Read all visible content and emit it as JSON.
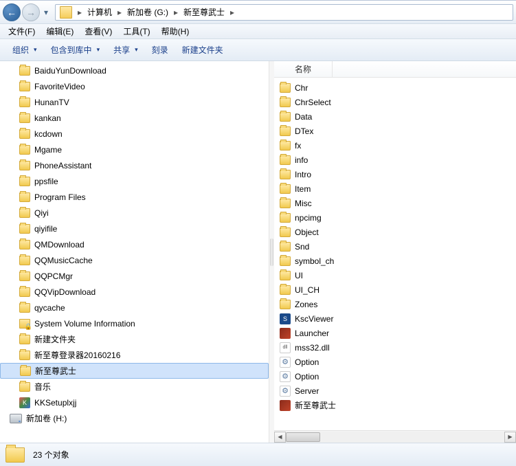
{
  "breadcrumb": [
    {
      "label": "计算机"
    },
    {
      "label": "新加卷 (G:)"
    },
    {
      "label": "新至尊武士"
    }
  ],
  "menubar": [
    {
      "label": "文件(F)"
    },
    {
      "label": "编辑(E)"
    },
    {
      "label": "查看(V)"
    },
    {
      "label": "工具(T)"
    },
    {
      "label": "帮助(H)"
    }
  ],
  "toolbar": [
    {
      "label": "组织",
      "drop": true
    },
    {
      "label": "包含到库中",
      "drop": true
    },
    {
      "label": "共享",
      "drop": true
    },
    {
      "label": "刻录"
    },
    {
      "label": "新建文件夹"
    }
  ],
  "tree": [
    {
      "label": "BaiduYunDownload",
      "icon": "folder"
    },
    {
      "label": "FavoriteVideo",
      "icon": "folder"
    },
    {
      "label": "HunanTV",
      "icon": "folder"
    },
    {
      "label": "kankan",
      "icon": "folder"
    },
    {
      "label": "kcdown",
      "icon": "folder"
    },
    {
      "label": "Mgame",
      "icon": "folder"
    },
    {
      "label": "PhoneAssistant",
      "icon": "folder"
    },
    {
      "label": "ppsfile",
      "icon": "folder"
    },
    {
      "label": "Program Files",
      "icon": "folder"
    },
    {
      "label": "Qiyi",
      "icon": "folder"
    },
    {
      "label": "qiyifile",
      "icon": "folder"
    },
    {
      "label": "QMDownload",
      "icon": "folder"
    },
    {
      "label": "QQMusicCache",
      "icon": "folder"
    },
    {
      "label": "QQPCMgr",
      "icon": "folder"
    },
    {
      "label": "QQVipDownload",
      "icon": "folder"
    },
    {
      "label": "qycache",
      "icon": "folder"
    },
    {
      "label": "System Volume Information",
      "icon": "svi"
    },
    {
      "label": "新建文件夹",
      "icon": "folder"
    },
    {
      "label": "新至尊登录器20160216",
      "icon": "folder"
    },
    {
      "label": "新至尊武士",
      "icon": "folder",
      "selected": true
    },
    {
      "label": "音乐",
      "icon": "folder"
    },
    {
      "label": "KKSetuplxjj",
      "icon": "kk"
    },
    {
      "label": "新加卷 (H:)",
      "icon": "drive",
      "level": 0
    }
  ],
  "list_header": {
    "name": "名称"
  },
  "list": [
    {
      "label": "Chr",
      "icon": "folder"
    },
    {
      "label": "ChrSelect",
      "icon": "folder"
    },
    {
      "label": "Data",
      "icon": "folder"
    },
    {
      "label": "DTex",
      "icon": "folder"
    },
    {
      "label": "fx",
      "icon": "folder"
    },
    {
      "label": "info",
      "icon": "folder"
    },
    {
      "label": "Intro",
      "icon": "folder"
    },
    {
      "label": "Item",
      "icon": "folder"
    },
    {
      "label": "Misc",
      "icon": "folder"
    },
    {
      "label": "npcimg",
      "icon": "folder"
    },
    {
      "label": "Object",
      "icon": "folder"
    },
    {
      "label": "Snd",
      "icon": "folder"
    },
    {
      "label": "symbol_ch",
      "icon": "folder"
    },
    {
      "label": "UI",
      "icon": "folder"
    },
    {
      "label": "UI_CH",
      "icon": "folder"
    },
    {
      "label": "Zones",
      "icon": "folder"
    },
    {
      "label": "KscViewer",
      "icon": "ksc"
    },
    {
      "label": "Launcher",
      "icon": "launcher"
    },
    {
      "label": "mss32.dll",
      "icon": "dll"
    },
    {
      "label": "Option",
      "icon": "ini"
    },
    {
      "label": "Option",
      "icon": "ini"
    },
    {
      "label": "Server",
      "icon": "ini"
    },
    {
      "label": "新至尊武士",
      "icon": "launcher"
    }
  ],
  "status": {
    "count_label": "23 个对象"
  }
}
